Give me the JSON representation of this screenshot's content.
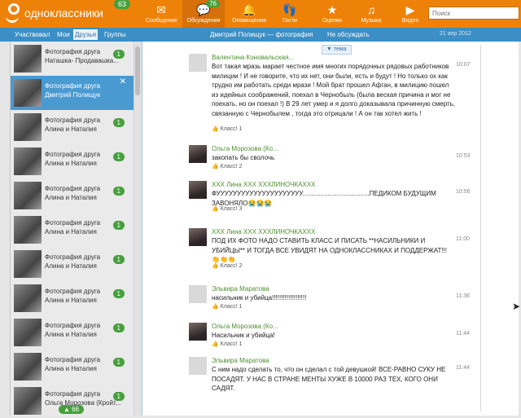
{
  "topbar": {
    "logo": "одноклассники",
    "logo_badge": "63",
    "nav": [
      {
        "label": "Сообщения",
        "icon": "envelope-icon",
        "glyph": "✉",
        "badge": ""
      },
      {
        "label": "Обсуждения",
        "icon": "chat-icon",
        "glyph": "💬",
        "badge": "76"
      },
      {
        "label": "Оповещения",
        "icon": "bell-icon",
        "glyph": "🔔",
        "badge": ""
      },
      {
        "label": "Гости",
        "icon": "footprints-icon",
        "glyph": "👣",
        "badge": ""
      },
      {
        "label": "Оценки",
        "icon": "rating-icon",
        "glyph": "★",
        "badge": ""
      },
      {
        "label": "Музыка",
        "icon": "music-icon",
        "glyph": "♫",
        "badge": ""
      },
      {
        "label": "Видео",
        "icon": "video-icon",
        "glyph": "▶",
        "badge": ""
      }
    ],
    "search_placeholder": "Поиск"
  },
  "subbar": {
    "tabs": [
      "Участвовал",
      "Мои",
      "Друзья",
      "Группы"
    ],
    "selected_tab": "Друзья",
    "title": "Дмитрий Полищук — фотография",
    "ignore": "Не обсуждать",
    "date": "21 апр 2012"
  },
  "sidebar": {
    "items": [
      {
        "line1": "Фотография друга",
        "line2": "Наташка- Продавашка...",
        "count": "1"
      },
      {
        "line1": "Фотография друга",
        "line2": "Дмитрий Полищук",
        "count": "",
        "selected": true
      },
      {
        "line1": "Фотография друга",
        "line2": "Алина и Наталия",
        "count": "1"
      },
      {
        "line1": "Фотография друга",
        "line2": "Алина и Наталия",
        "count": "1"
      },
      {
        "line1": "Фотография друга",
        "line2": "Алина и Наталия",
        "count": "1"
      },
      {
        "line1": "Фотография друга",
        "line2": "Алина и Наталия",
        "count": "1"
      },
      {
        "line1": "Фотография друга",
        "line2": "Алина и Наталия",
        "count": "1"
      },
      {
        "line1": "Фотография друга",
        "line2": "Алина и Наталия",
        "count": "1"
      },
      {
        "line1": "Фотография друга",
        "line2": "Алина и Наталия",
        "count": "1"
      },
      {
        "line1": "Фотография друга",
        "line2": "Алина и Наталия",
        "count": "1"
      },
      {
        "line1": "Фотография друга",
        "line2": "Ольга Морозова (Кройт...",
        "count": "1"
      }
    ],
    "bottom_badge": "66"
  },
  "main": {
    "theme_tab": "▼ тема",
    "messages": [
      {
        "name": "Валентина Коновальская...",
        "text": "Вот такая мразь марает честное имя многих порядочных рядовых работников милиции ! И не говорите, что их нет, они были, есть и будут ! Но только ох как трудно им работать среди мрази ! Мой брат прошел Афган, в милицию пошел из идейных соображений, поехал в Чернобыль (была веская причина и мог не поехать, но он поехал !) В 29 лет умер и я долго доказывала причинную смерть, связанную с Чернобылем , тогда это отрицали ! А он так хотел жить !",
        "like": "Класс! 1",
        "time": "10:07",
        "photo": false
      },
      {
        "name": "Ольга Морозова (Ко...",
        "text": "закопать бы сволочь",
        "like": "Класс! 2",
        "time": "10:53",
        "photo": true
      },
      {
        "name": "XXX Лина XXX XXXЛИНОЧКАXXX",
        "text": "ФУУУУУУУУУУУУУУУУУУУУУ.....................................ПЕДИКОМ БУДУЩИМ ЗАВОНЯЛО😭😭😭",
        "like": "Класс! 3",
        "time": "10:56",
        "photo": true
      },
      {
        "name": "XXX Лина XXX XXXЛИНОЧКАXXX",
        "text": "ПОД ИХ ФОТО НАДО СТАВИТЬ КЛАСС И ПИСАТЬ **НАСИЛЬНИКИ И УБИЙЦЫ** И ТОГДА ВСЕ УВИДЯТ НА ОДНОКЛАССНИКАХ И ПОДДЕРЖАТ!!! 👏👏👏",
        "like": "Класс! 2",
        "time": "11:00",
        "photo": true
      },
      {
        "name": "Эльвира Маратова",
        "text": "насильник и убийца!!!!!!!!!!!!!!!!!!!",
        "like": "Класс! 1",
        "time": "11:36",
        "photo": false
      },
      {
        "name": "Ольга Морозова (Ко...",
        "text": "Насильник и убийца!",
        "like": "Класс! 1",
        "time": "11:44",
        "photo": true
      },
      {
        "name": "Эльвира Маратова",
        "text": "С ним надо сделать то, что он сделал с той девушкой! ВСЕ-РАВНО СУКУ НЕ ПОСАДЯТ. У НАС В СТРАНЕ МЕНТЫ ХУЖЕ В 10000 РАЗ ТЕХ, КОГО ОНИ САДЯТ.",
        "like": "",
        "time": "11:44",
        "photo": false
      }
    ]
  }
}
